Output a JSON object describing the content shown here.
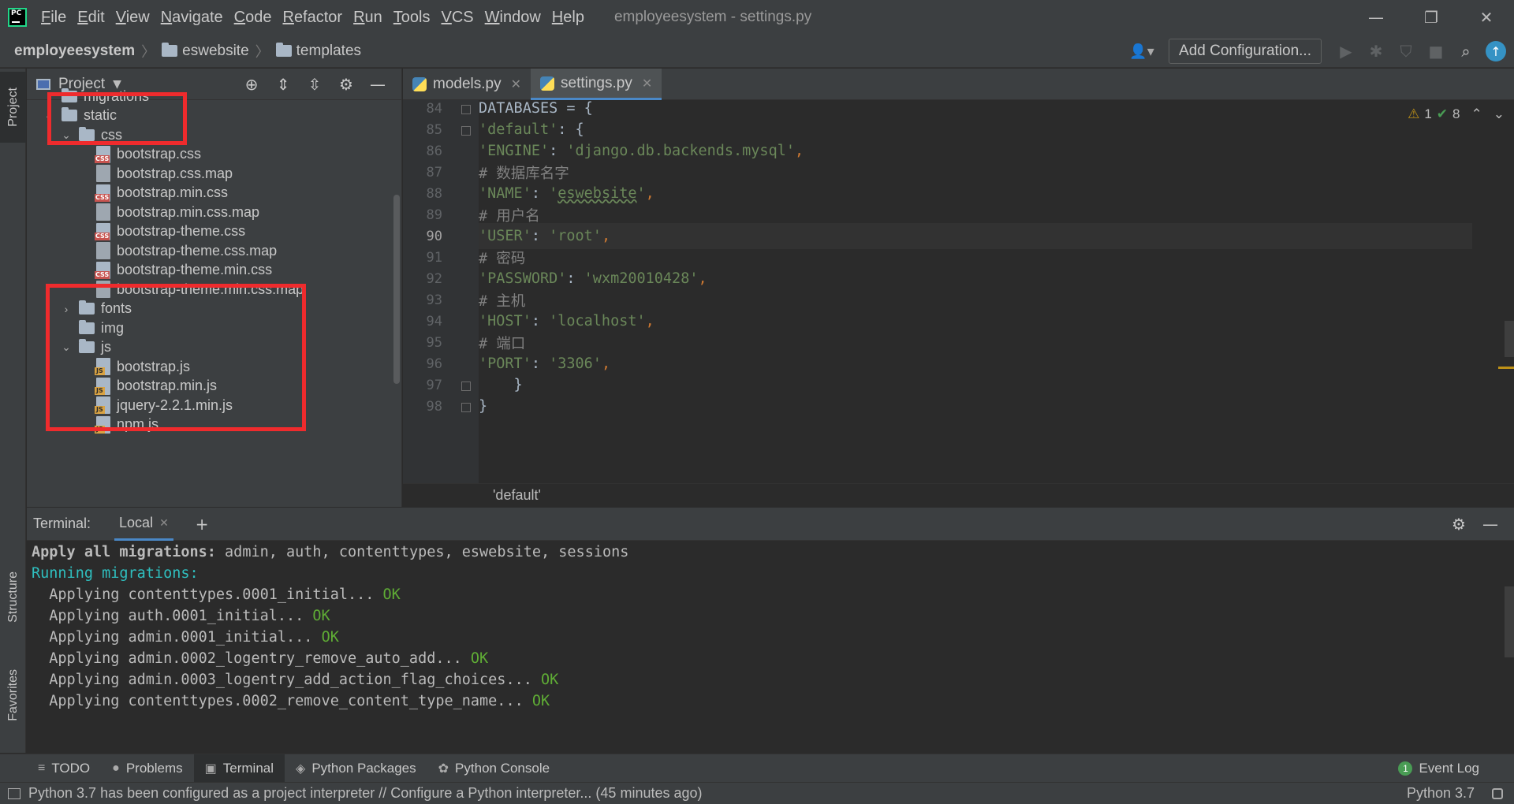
{
  "titlebar": {
    "logo_text": "PC",
    "menu": [
      "File",
      "Edit",
      "View",
      "Navigate",
      "Code",
      "Refactor",
      "Run",
      "Tools",
      "VCS",
      "Window",
      "Help"
    ],
    "menu_mnemonic_first": [
      "F",
      "E",
      "V",
      "N",
      "C",
      "R",
      "R",
      "T",
      "V",
      "W",
      "H"
    ],
    "window_title": "employeesystem - settings.py",
    "controls": {
      "minimize": "—",
      "restore": "❐",
      "close": "✕"
    }
  },
  "navbar": {
    "breadcrumbs": [
      "employeesystem",
      "eswebsite",
      "templates"
    ],
    "add_configuration": "Add Configuration..."
  },
  "left_stripe": {
    "project_tab": "Project",
    "structure_tab": "Structure",
    "favorites_tab": "Favorites"
  },
  "project": {
    "title": "Project",
    "tree": [
      {
        "label": "migrations",
        "type": "folder",
        "arrow": "›",
        "indent": 1
      },
      {
        "label": "static",
        "type": "folder",
        "arrow": "⌄",
        "indent": 1
      },
      {
        "label": "css",
        "type": "folder",
        "arrow": "⌄",
        "indent": 2
      },
      {
        "label": "bootstrap.css",
        "type": "css",
        "indent": 3
      },
      {
        "label": "bootstrap.css.map",
        "type": "map",
        "indent": 3
      },
      {
        "label": "bootstrap.min.css",
        "type": "css",
        "indent": 3
      },
      {
        "label": "bootstrap.min.css.map",
        "type": "map",
        "indent": 3
      },
      {
        "label": "bootstrap-theme.css",
        "type": "css",
        "indent": 3
      },
      {
        "label": "bootstrap-theme.css.map",
        "type": "map",
        "indent": 3
      },
      {
        "label": "bootstrap-theme.min.css",
        "type": "css",
        "indent": 3
      },
      {
        "label": "bootstrap-theme.min.css.map",
        "type": "map",
        "indent": 3
      },
      {
        "label": "fonts",
        "type": "folder",
        "arrow": "›",
        "indent": 2
      },
      {
        "label": "img",
        "type": "folder",
        "arrow": "",
        "indent": 2
      },
      {
        "label": "js",
        "type": "folder",
        "arrow": "⌄",
        "indent": 2
      },
      {
        "label": "bootstrap.js",
        "type": "js",
        "indent": 3
      },
      {
        "label": "bootstrap.min.js",
        "type": "js",
        "indent": 3
      },
      {
        "label": "jquery-2.2.1.min.js",
        "type": "js",
        "indent": 3
      },
      {
        "label": "npm.js",
        "type": "js",
        "indent": 3
      }
    ]
  },
  "editor": {
    "tabs": [
      {
        "label": "models.py",
        "active": false
      },
      {
        "label": "settings.py",
        "active": true
      }
    ],
    "inspections": {
      "warnings": "1",
      "ok": "8"
    },
    "lines": [
      {
        "no": "84",
        "html": "DATABASES = {"
      },
      {
        "no": "85",
        "html": "    <span class=\"s\">'default'</span>: {"
      },
      {
        "no": "86",
        "html": "        <span class=\"s\">'ENGINE'</span>: <span class=\"s\">'django.db.backends.mysql'</span><span class=\"p\">,</span>"
      },
      {
        "no": "87",
        "html": "        <span class=\"c\"># 数据库名字</span>"
      },
      {
        "no": "88",
        "html": "        <span class=\"s\">'NAME'</span>: <span class=\"s\">'<span class=\"wavy\">eswebsite</span>'</span><span class=\"p\">,</span>"
      },
      {
        "no": "89",
        "html": "        <span class=\"c\"># 用户名</span>"
      },
      {
        "no": "90",
        "html": "        <span class=\"s\">'USER'</span>: <span class=\"s\">'root'</span><span class=\"p\">,</span>"
      },
      {
        "no": "91",
        "html": "        <span class=\"c\"># 密码</span>"
      },
      {
        "no": "92",
        "html": "        <span class=\"s\">'PASSWORD'</span>: <span class=\"s\">'wxm20010428'</span><span class=\"p\">,</span>"
      },
      {
        "no": "93",
        "html": "        <span class=\"c\"># 主机</span>"
      },
      {
        "no": "94",
        "html": "        <span class=\"s\">'HOST'</span>: <span class=\"s\">'localhost'</span><span class=\"p\">,</span>"
      },
      {
        "no": "95",
        "html": "        <span class=\"c\"># 端口</span>"
      },
      {
        "no": "96",
        "html": "        <span class=\"s\">'PORT'</span>: <span class=\"s\">'3306'</span><span class=\"p\">,</span>"
      },
      {
        "no": "97",
        "html": "    }"
      },
      {
        "no": "98",
        "html": "}"
      }
    ],
    "current_line": "90",
    "breadcrumb": "'default'"
  },
  "terminal": {
    "title": "Terminal:",
    "tab": "Local",
    "add": "+",
    "lines": [
      {
        "html": "  <span class=\"bold\">Apply all migrations:</span> admin, auth, contenttypes, eswebsite, sessions"
      },
      {
        "html": "<span class=\"cyan\">Running migrations:</span>"
      },
      {
        "html": "  Applying contenttypes.0001_initial... <span class=\"ok\">OK</span>"
      },
      {
        "html": "  Applying auth.0001_initial... <span class=\"ok\">OK</span>"
      },
      {
        "html": "  Applying admin.0001_initial... <span class=\"ok\">OK</span>"
      },
      {
        "html": "  Applying admin.0002_logentry_remove_auto_add... <span class=\"ok\">OK</span>"
      },
      {
        "html": "  Applying admin.0003_logentry_add_action_flag_choices... <span class=\"ok\">OK</span>"
      },
      {
        "html": "  Applying contenttypes.0002_remove_content_type_name... <span class=\"ok\">OK</span>"
      }
    ]
  },
  "bottom_tools": [
    {
      "label": "TODO",
      "icon": "≡",
      "active": false
    },
    {
      "label": "Problems",
      "icon": "●",
      "active": false
    },
    {
      "label": "Terminal",
      "icon": "▣",
      "active": true
    },
    {
      "label": "Python Packages",
      "icon": "◈",
      "active": false
    },
    {
      "label": "Python Console",
      "icon": "✿",
      "active": false
    }
  ],
  "event_log": {
    "count": "1",
    "label": "Event Log"
  },
  "status": {
    "message": "Python 3.7 has been configured as a project interpreter // Configure a Python interpreter... (45 minutes ago)",
    "interpreter": "Python 3.7"
  }
}
